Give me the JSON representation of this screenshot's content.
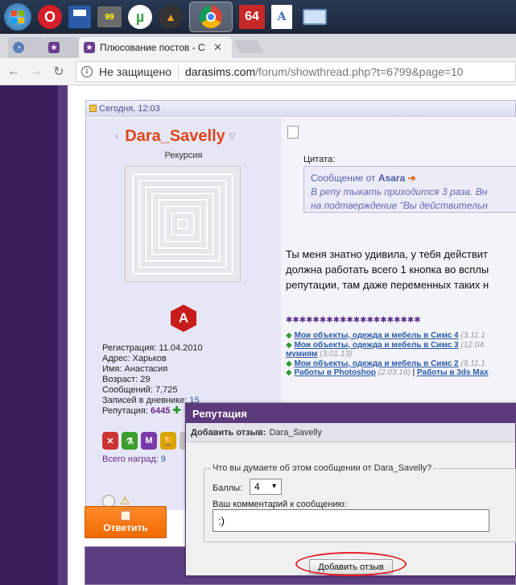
{
  "taskbar": {
    "icons": [
      {
        "name": "windows-start-icon",
        "label": "",
        "color": "#4d9be0"
      },
      {
        "name": "opera-icon",
        "label": "O",
        "color": "#d41f2a"
      },
      {
        "name": "floppy-disk-icon",
        "label": "",
        "color": "#2a5aa8"
      },
      {
        "name": "monitor-99-icon",
        "label": "99",
        "color": "#6b6b6b"
      },
      {
        "name": "utorrent-icon",
        "label": "µ",
        "color": "#3aa345"
      },
      {
        "name": "aimp-icon",
        "label": "▲",
        "color": "#f0a020"
      },
      {
        "name": "chrome-icon",
        "label": "",
        "color": "#e8c200"
      },
      {
        "name": "aida64-icon",
        "label": "64",
        "color": "#c62828"
      },
      {
        "name": "document-icon",
        "label": "A",
        "color": "#3b6bbd"
      },
      {
        "name": "display-settings-icon",
        "label": "",
        "color": "#6a8fbd"
      }
    ]
  },
  "browser": {
    "tab_title": "Плюсование постов - С",
    "tab_close": "✕",
    "security_text": "Не защищено",
    "url_domain": "darasims.com",
    "url_path": "/forum/showthread.php?t=6799&page=10"
  },
  "post": {
    "date": "Сегодня, 12:03",
    "username": "Dara_Savelly",
    "user_title": "Рекурсия",
    "admin_badge": "A",
    "stats": {
      "registration": "Регистрация: 11.04.2010",
      "address": "Адрес: Харьков",
      "name": "Имя: Анастасия",
      "age": "Возраст: 29",
      "messages": "Сообщений: 7,725",
      "diary_label": "Записей в дневнике: ",
      "diary_value": "15",
      "rep_label": "Репутация: ",
      "rep_value": "6445"
    },
    "awards_label": "Всего наград: ",
    "awards_value": "9",
    "quote_label": "Цитата:",
    "quote_from_prefix": "Сообщение от ",
    "quote_author": "Asara",
    "quote_line1": "В репу тыкать приходится 3 раза. Вн",
    "quote_line2": "на подтверждение \"Вы действительн",
    "message_lines": [
      "Ты меня знатно удивила, у тебя действит",
      "должна работать всего 1 кнопка во всплы",
      "репутации, там даже переменных таких н"
    ],
    "stars": "✱✱✱✱✱✱✱✱✱✱✱✱✱✱✱✱✱✱✱✱",
    "sig": {
      "link1": "Мои объекты, одежда и мебель в Симс 4",
      "date1": "(3.11.1",
      "link2": "Мои объекты, одежда и мебель в Симс 3",
      "date2": "(12.04.",
      "link3": "мумиям",
      "date3": "(3.01.13)",
      "link4": "Мои объекты, одежда и мебель в Симс 2",
      "date4": "(9.11.1",
      "link5": "Работы в Photoshop",
      "date5": "(2.03.16)",
      "sep": "|",
      "link6": "Работы в 3ds Max"
    },
    "reply_button": "Ответить"
  },
  "modal": {
    "title": "Репутация",
    "subtitle_bold": "Добавить отзыв:",
    "subtitle_user": "Dara_Savelly",
    "legend": "Что вы думаете об этом сообщении от Dara_Savelly?",
    "points_label": "Баллы:",
    "points_value": "4",
    "comment_label": "Ваш комментарий к сообщению:",
    "comment_value": ":)",
    "submit": "Добавить отзыв"
  },
  "colors": {
    "accent_purple": "#5c3a7c",
    "username_orange": "#e0451b",
    "highlight_red": "#e41e26",
    "reply_orange": "#ee6a00"
  }
}
